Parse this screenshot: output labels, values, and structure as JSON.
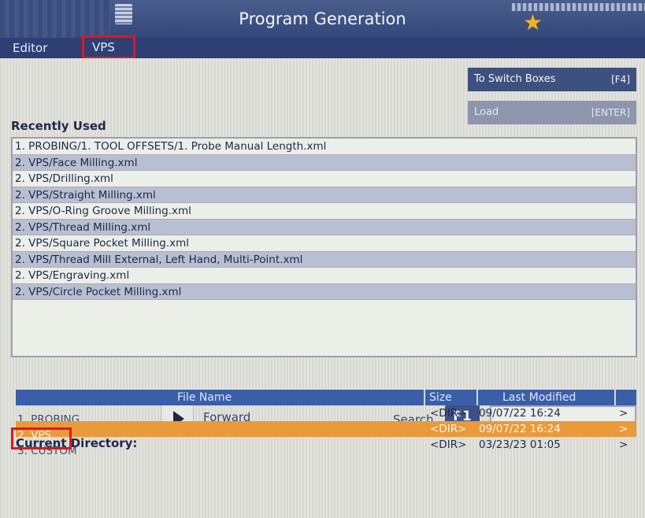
{
  "window": {
    "title": "Program Generation"
  },
  "tabs": [
    {
      "label": "Editor"
    },
    {
      "label": "VPS"
    }
  ],
  "buttons": {
    "switch_boxes": {
      "label": "To Switch Boxes",
      "key": "[F4]"
    },
    "load": {
      "label": "Load",
      "key": "[ENTER]"
    }
  },
  "recent": {
    "label": "Recently Used",
    "items": [
      "1. PROBING/1. TOOL OFFSETS/1. Probe Manual Length.xml",
      "2. VPS/Face Milling.xml",
      "2. VPS/Drilling.xml",
      "2. VPS/Straight Milling.xml",
      "2. VPS/O-Ring Groove Milling.xml",
      "2. VPS/Thread Milling.xml",
      "2. VPS/Square Pocket Milling.xml",
      "2. VPS/Thread Mill External, Left Hand, Multi-Point.xml",
      "2. VPS/Engraving.xml",
      "2. VPS/Circle Pocket Milling.xml"
    ]
  },
  "search": {
    "forward_label": "Forward",
    "search_label": "Search",
    "key": "F1",
    "value": ""
  },
  "directory": {
    "label": "Current Directory:",
    "columns": {
      "name": "File Name",
      "size": "Size",
      "modified": "Last Modified"
    },
    "rows": [
      {
        "name": "1. PROBING",
        "size": "<DIR>",
        "modified": "09/07/22 16:24",
        "arrow": ">"
      },
      {
        "name": "2. VPS",
        "size": "<DIR>",
        "modified": "09/07/22 16:24",
        "arrow": ">"
      },
      {
        "name": "3. CUSTOM",
        "size": "<DIR>",
        "modified": "03/23/23 01:05",
        "arrow": ">"
      }
    ],
    "selected_index": 1
  },
  "colors": {
    "accent": "#3e5184",
    "selection": "#e99a3a",
    "highlight_outline": "#e0171f"
  }
}
